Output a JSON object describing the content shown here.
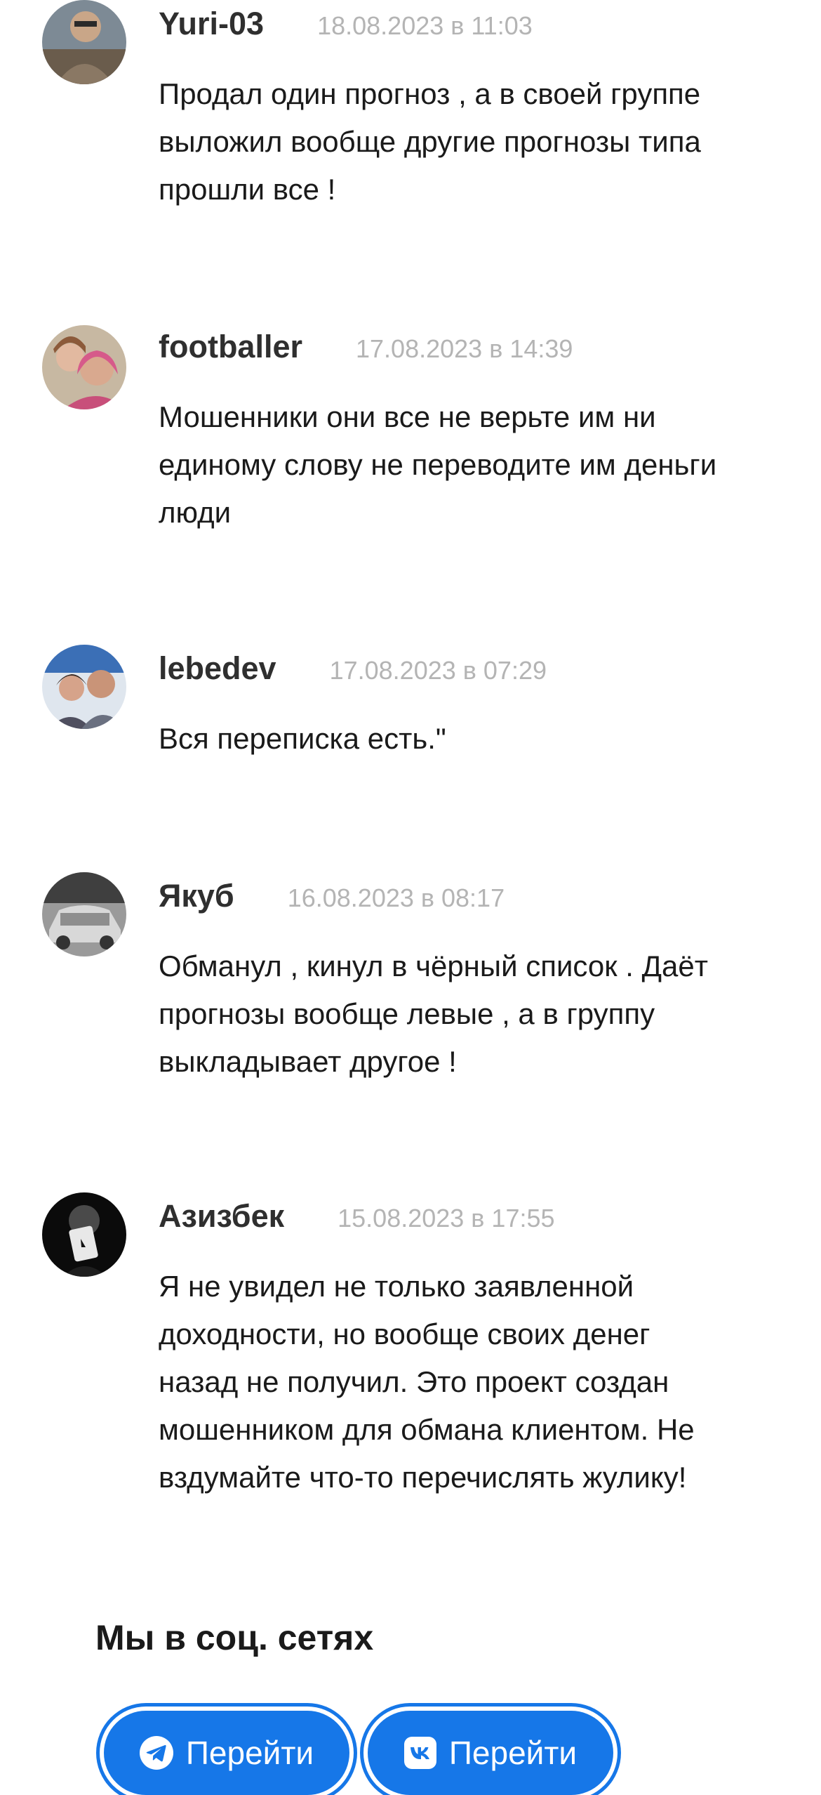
{
  "comments": [
    {
      "author": "Yuri-03",
      "date": "18.08.2023 в 11:03",
      "lines": [
        "Продал один прогноз , а в своей группе",
        "выложил вообще другие прогнозы типа",
        "прошли все !"
      ]
    },
    {
      "author": "footballer",
      "date": "17.08.2023 в 14:39",
      "lines": [
        "Мошенники они все не верьте им ни",
        "единому слову не переводите им деньги",
        "люди"
      ]
    },
    {
      "author": "lebedev",
      "date": "17.08.2023 в 07:29",
      "lines": [
        "Вся переписка есть.\""
      ]
    },
    {
      "author": "Якуб",
      "date": "16.08.2023 в 08:17",
      "lines": [
        "Обманул , кинул в чёрный список . Даёт",
        "прогнозы вообще левые , а в группу",
        "выкладывает другое !"
      ]
    },
    {
      "author": "Азизбек",
      "date": "15.08.2023 в 17:55",
      "lines": [
        "Я не увидел не только заявленной",
        "доходности, но вообще своих денег",
        "назад не получил. Это проект создан",
        "мошенником для обмана клиентом. Не",
        "вздумайте что-то перечислять жулику!"
      ]
    }
  ],
  "social": {
    "title": "Мы в соц. сетях",
    "buttons": [
      {
        "icon": "telegram-icon",
        "label": "Перейти"
      },
      {
        "icon": "vk-icon",
        "label": "Перейти"
      }
    ]
  },
  "colors": {
    "accent": "#1677e8",
    "date": "#b4b4b4",
    "text": "#1a1a1a"
  }
}
